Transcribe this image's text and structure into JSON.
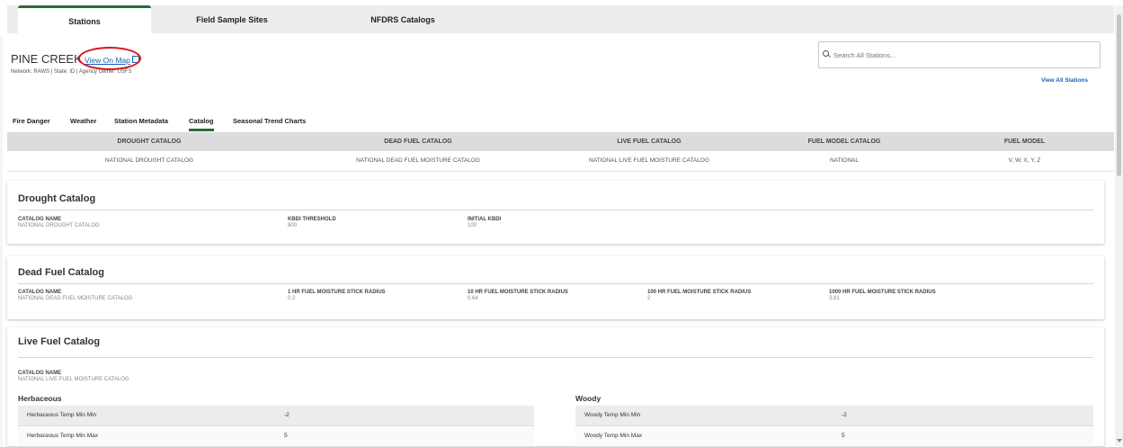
{
  "top_tabs": [
    {
      "label": "Stations",
      "active": true
    },
    {
      "label": "Field Sample Sites",
      "active": false
    },
    {
      "label": "NFDRS Catalogs",
      "active": false
    }
  ],
  "station": {
    "name": "PINE CREEK",
    "map_link": "View On Map",
    "meta": "Network: RAWS | State: ID | Agency Owner: USFS"
  },
  "search": {
    "placeholder": "Search All Stations..."
  },
  "view_all": "View All Stations",
  "sub_tabs": [
    {
      "label": "Fire Danger",
      "active": false
    },
    {
      "label": "Weather",
      "active": false
    },
    {
      "label": "Station Metadata",
      "active": false
    },
    {
      "label": "Catalog",
      "active": true
    },
    {
      "label": "Seasonal Trend Charts",
      "active": false
    }
  ],
  "catalog_table": {
    "headers": [
      "DROUGHT CATALOG",
      "DEAD FUEL CATALOG",
      "LIVE FUEL CATALOG",
      "FUEL MODEL CATALOG",
      "FUEL MODEL"
    ],
    "row": [
      "NATIONAL DROUGHT CATALOG",
      "NATIONAL DEAD FUEL MOISTURE CATALOG",
      "NATIONAL LIVE FUEL MOISTURE CATALOG",
      "NATIONAL",
      "V, W, X, Y, Z"
    ]
  },
  "drought": {
    "title": "Drought Catalog",
    "fields": [
      {
        "label": "CATALOG NAME",
        "value": "NATIONAL DROUGHT CATALOG"
      },
      {
        "label": "KBDI THRESHOLD",
        "value": "800"
      },
      {
        "label": "INITIAL KBDI",
        "value": "100"
      }
    ]
  },
  "dead_fuel": {
    "title": "Dead Fuel Catalog",
    "fields": [
      {
        "label": "CATALOG NAME",
        "value": "NATIONAL DEAD FUEL MOISTURE CATALOG"
      },
      {
        "label": "1 HR FUEL MOISTURE STICK RADIUS",
        "value": "0.2"
      },
      {
        "label": "10 HR FUEL MOISTURE STICK RADIUS",
        "value": "0.64"
      },
      {
        "label": "100 HR FUEL MOISTURE STICK RADIUS",
        "value": "2"
      },
      {
        "label": "1000 HR FUEL MOISTURE STICK RADIUS",
        "value": "3.81"
      }
    ]
  },
  "live_fuel": {
    "title": "Live Fuel Catalog",
    "catalog_label": "CATALOG NAME",
    "catalog_value": "NATIONAL LIVE FUEL MOISTURE CATALOG",
    "herbaceous": {
      "title": "Herbaceous",
      "rows": [
        {
          "name": "Herbaceous Temp Min Min",
          "value": "-2"
        },
        {
          "name": "Herbaceous Temp Min Max",
          "value": "5"
        }
      ]
    },
    "woody": {
      "title": "Woody",
      "rows": [
        {
          "name": "Woody Temp Min Min",
          "value": "-2"
        },
        {
          "name": "Woody Temp Min Max",
          "value": "5"
        }
      ]
    }
  },
  "colors": {
    "accent_green": "#2a6b35",
    "link_blue": "#1a5fb4",
    "annotation_red": "#d8141c"
  }
}
